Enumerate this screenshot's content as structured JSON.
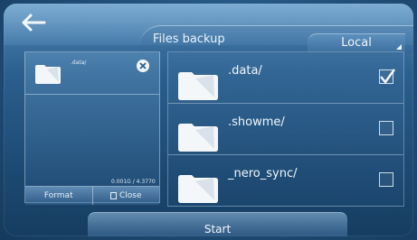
{
  "header": {
    "title": "Files backup",
    "location": "Local"
  },
  "selected": {
    "name": ".data/",
    "storage_text": "0.001G / 4.3770",
    "format_label": "Format",
    "close_label": "Close"
  },
  "files": [
    {
      "name": ".data/",
      "checked": true
    },
    {
      "name": ".showme/",
      "checked": false
    },
    {
      "name": "_nero_sync/",
      "checked": false
    }
  ],
  "footer": {
    "start_label": "Start"
  },
  "icons": {
    "back": "back-arrow-icon",
    "folder": "folder-icon",
    "close": "close-circle-icon",
    "checkbox": "checkbox-icon"
  }
}
